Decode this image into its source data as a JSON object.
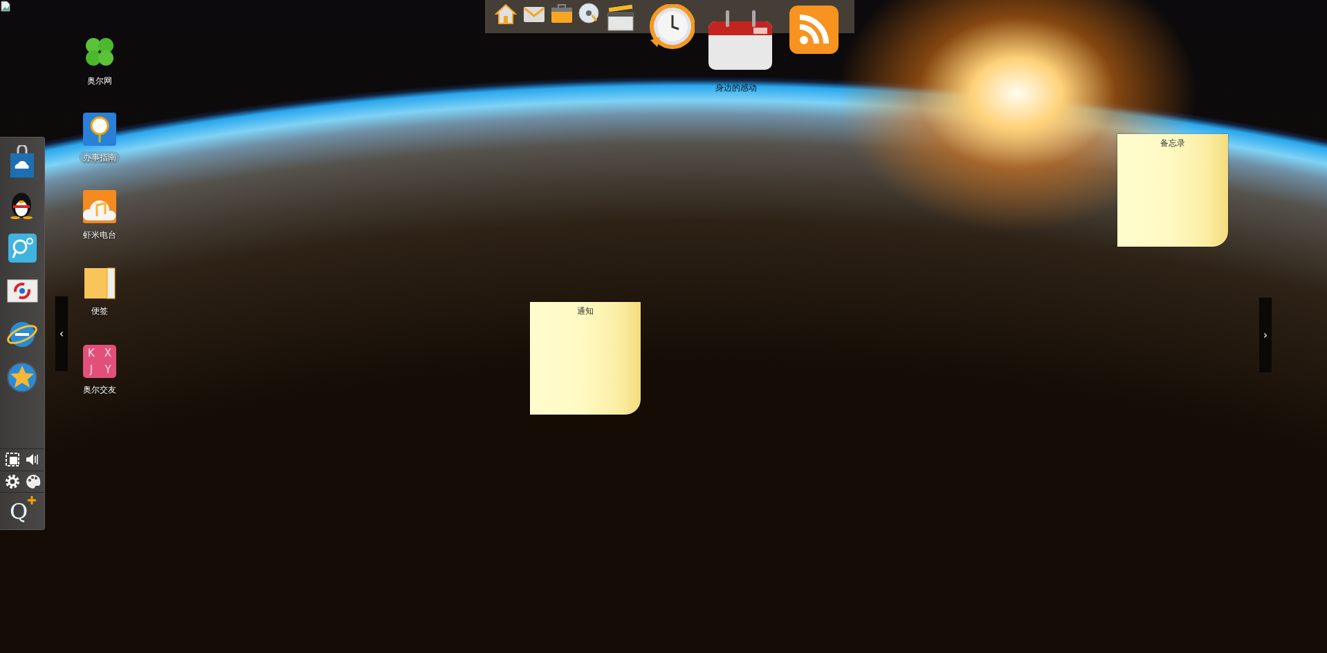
{
  "top_dock": {
    "widget_label": "身边的感动"
  },
  "desktop_icons": [
    {
      "label": "奥尔网",
      "selected": false
    },
    {
      "label": "办事指南",
      "selected": true
    },
    {
      "label": "虾米电台",
      "selected": false
    },
    {
      "label": "便签",
      "selected": false
    },
    {
      "label": "奥尔交友",
      "selected": false,
      "tiles": [
        "K",
        "X",
        "J",
        "Y"
      ]
    }
  ],
  "left_dock": {
    "logo_text": "Q"
  },
  "page_handles": {
    "left": "‹",
    "right": "›"
  },
  "notes": [
    {
      "title": "备忘录"
    },
    {
      "title": "通知"
    }
  ]
}
